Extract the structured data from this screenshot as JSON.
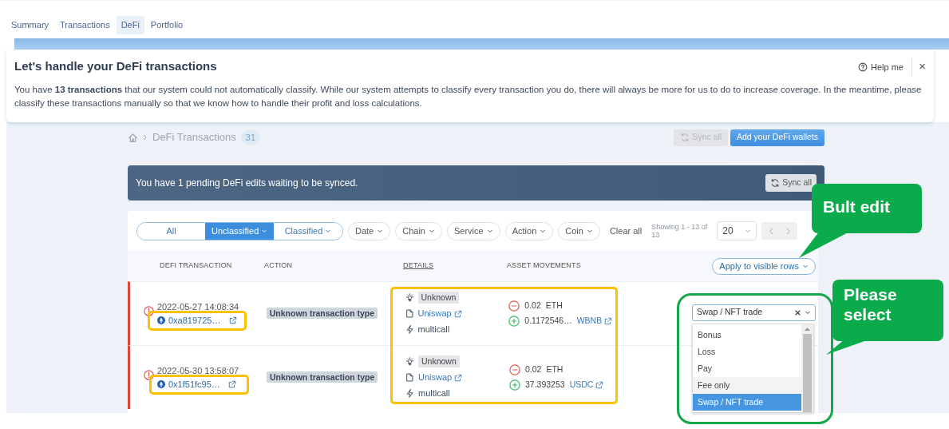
{
  "tabs": [
    {
      "label": "Summary",
      "selected": false
    },
    {
      "label": "Transactions",
      "selected": false
    },
    {
      "label": "DeFi",
      "selected": true
    },
    {
      "label": "Portfolio",
      "selected": false
    }
  ],
  "dialog": {
    "title": "Let's handle your DeFi transactions",
    "help": "Help me",
    "close": "×",
    "body": "You have **13 transactions** that our system could not automatically classify. While our system attempts to classify every transaction you do, there will always be more for us to do to increase coverage. In the meantime, please classify these transactions manually so that we know how to handle their profit and loss calculations."
  },
  "breadcrumb": {
    "label": "DeFi Transactions",
    "count": "31"
  },
  "header_buttons": [
    {
      "label": "Sync all",
      "kind": "sync"
    },
    {
      "label": "Add your DeFi wallets",
      "kind": "primary"
    }
  ],
  "pending": {
    "text": "You have 1 pending DeFi edits waiting to be synced.",
    "button": "Sync all"
  },
  "segments": [
    {
      "label": "All",
      "selected": false,
      "caret": false
    },
    {
      "label": "Unclassified",
      "selected": true,
      "caret": true
    },
    {
      "label": "Classified",
      "selected": false,
      "caret": true
    }
  ],
  "filters": [
    "Date",
    "Chain",
    "Service",
    "Action",
    "Coin"
  ],
  "clear_all": "Clear all",
  "showing": "Showing 1 - 13 of 13",
  "page_size": "20",
  "columns": [
    {
      "label": "DEFI TRANSACTION",
      "underlined": false
    },
    {
      "label": "ACTION",
      "underlined": false
    },
    {
      "label": "DETAILS",
      "underlined": true
    },
    {
      "label": "ASSET MOVEMENTS",
      "underlined": false
    }
  ],
  "apply_button": "Apply to visible rows",
  "rows": [
    {
      "datetime": "2022-05-27 14:08:34",
      "hash": "0xa819725…",
      "action": "Unknown transaction type",
      "status": "Unknown",
      "service": "Uniswap",
      "method": "multicall",
      "movements": [
        {
          "kind": "out",
          "amount": "0.02",
          "coin": "ETH",
          "linked": false
        },
        {
          "kind": "in",
          "amount": "0.1172546…",
          "coin": "WBNB",
          "linked": true
        }
      ],
      "select": "Swap / NFT trade"
    },
    {
      "datetime": "2022-05-30 13:58:07",
      "hash": "0x1f51fc95…",
      "action": "Unknown transaction type",
      "status": "Unknown",
      "service": "Uniswap",
      "method": "multicall",
      "movements": [
        {
          "kind": "out",
          "amount": "0.02",
          "coin": "ETH",
          "linked": false
        },
        {
          "kind": "in",
          "amount": "37.393253",
          "coin": "USDC",
          "linked": true
        }
      ]
    }
  ],
  "dropdown": [
    {
      "label": "Bonus",
      "selected": false,
      "hovered": false
    },
    {
      "label": "Loss",
      "selected": false,
      "hovered": false
    },
    {
      "label": "Pay",
      "selected": false,
      "hovered": false
    },
    {
      "label": "Fee only",
      "selected": false,
      "hovered": true
    },
    {
      "label": "Swap / NFT trade",
      "selected": true,
      "hovered": false
    }
  ],
  "callouts": [
    {
      "text": "Bult edit"
    },
    {
      "text": "Please select"
    }
  ]
}
